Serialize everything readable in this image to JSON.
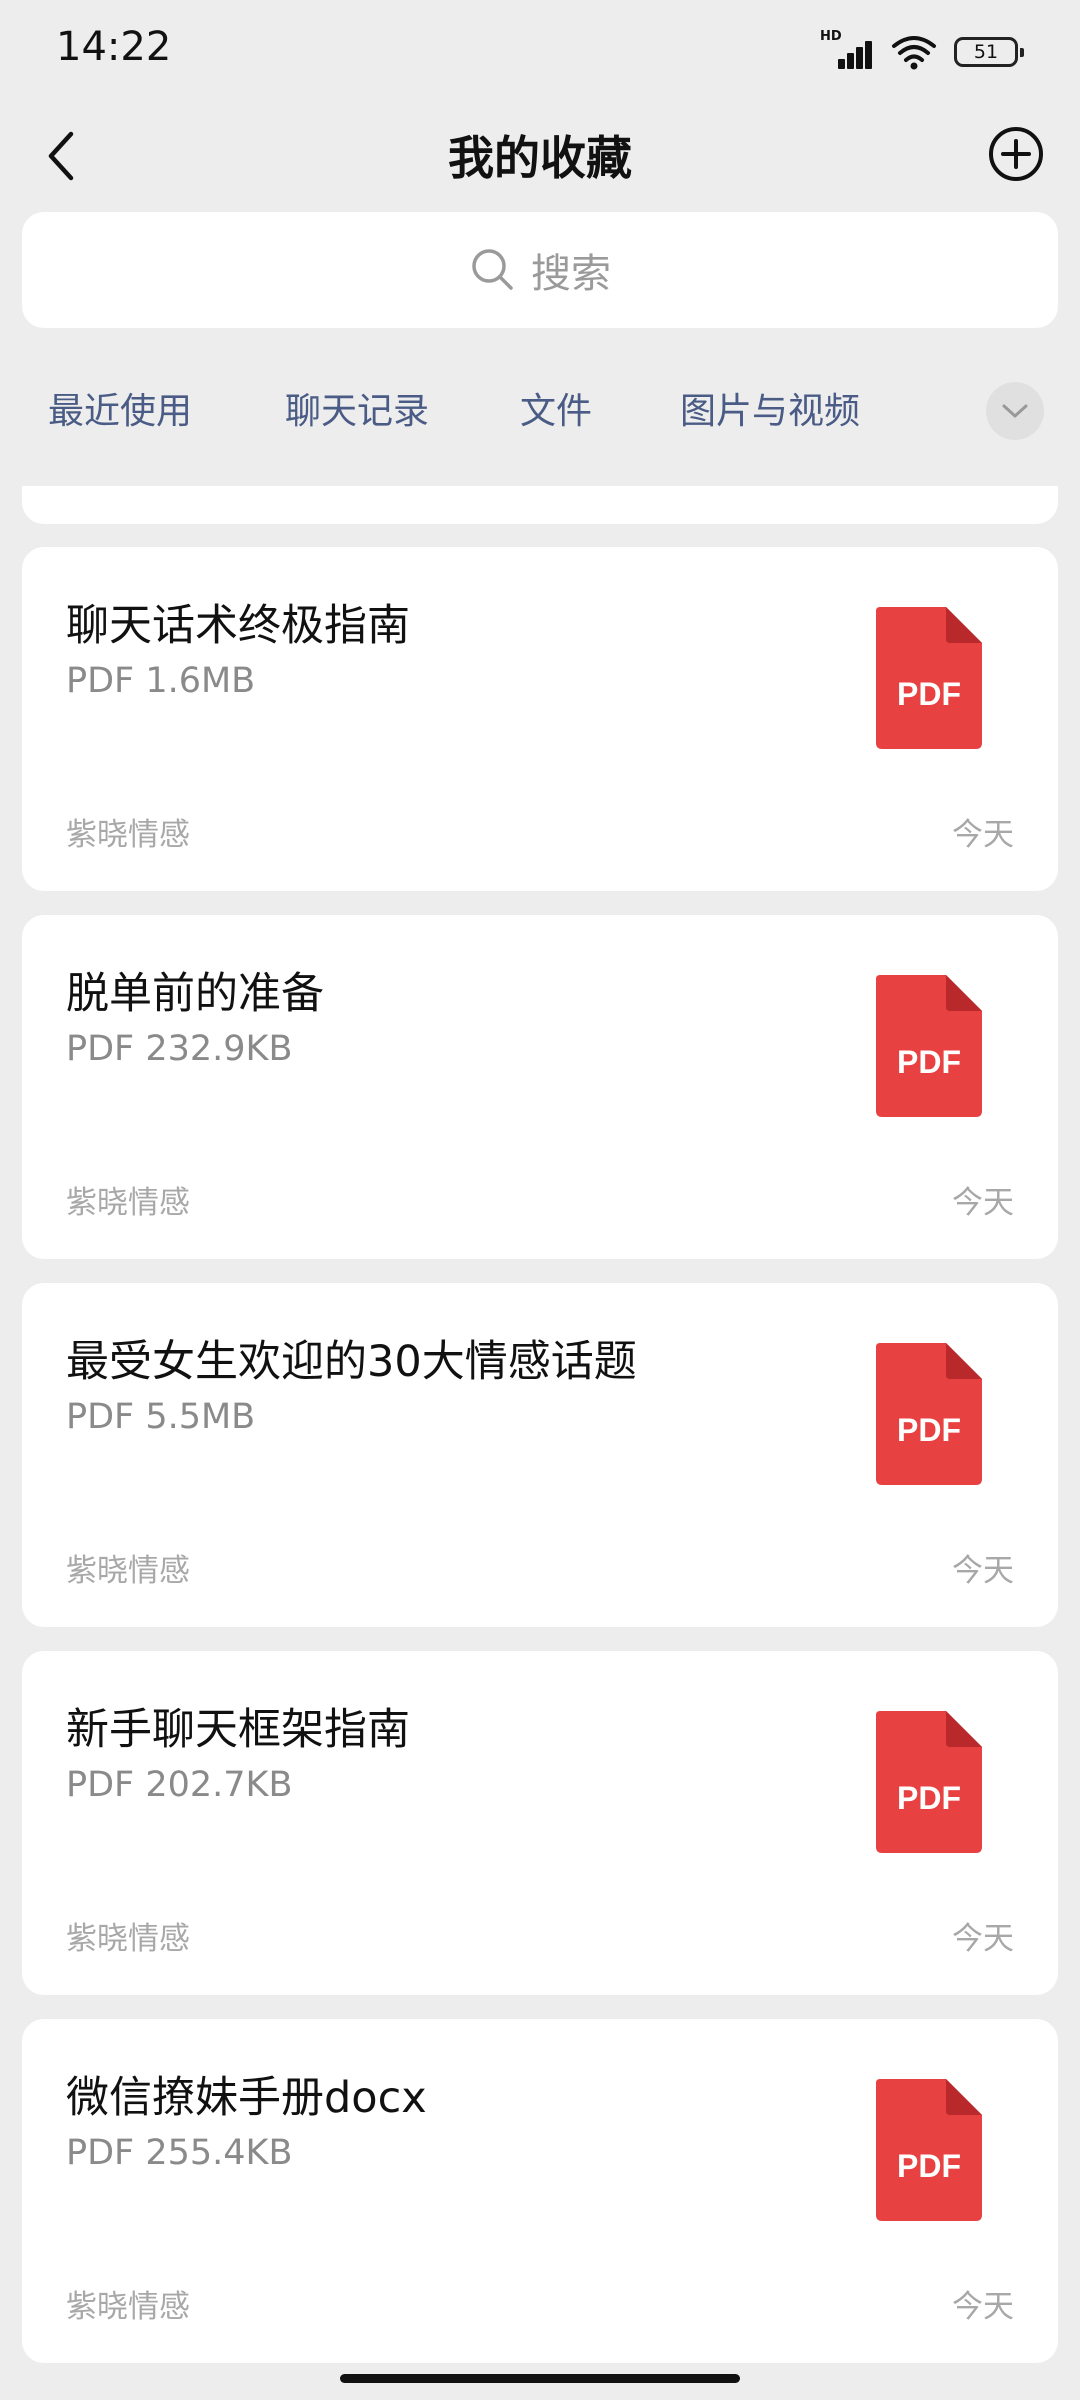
{
  "status_bar": {
    "time": "14:22",
    "network_label": "HD",
    "battery": "51"
  },
  "header": {
    "title": "我的收藏",
    "back_icon": "chevron-left-icon",
    "add_icon": "plus-circle-icon"
  },
  "search": {
    "placeholder": "搜索",
    "icon": "search-icon"
  },
  "tabs": [
    {
      "label": "最近使用"
    },
    {
      "label": "聊天记录"
    },
    {
      "label": "文件"
    },
    {
      "label": "图片与视频"
    }
  ],
  "tabs_more_icon": "chevron-down-icon",
  "items": [
    {
      "title": "聊天话术终极指南",
      "meta": "PDF 1.6MB",
      "source": "紫晓情感",
      "time": "今天",
      "file_badge": "PDF"
    },
    {
      "title": "脱单前的准备",
      "meta": "PDF 232.9KB",
      "source": "紫晓情感",
      "time": "今天",
      "file_badge": "PDF"
    },
    {
      "title": "最受女生欢迎的30大情感话题",
      "meta": "PDF 5.5MB",
      "source": "紫晓情感",
      "time": "今天",
      "file_badge": "PDF"
    },
    {
      "title": "新手聊天框架指南",
      "meta": "PDF 202.7KB",
      "source": "紫晓情感",
      "time": "今天",
      "file_badge": "PDF"
    },
    {
      "title": "微信撩妹手册docx",
      "meta": "PDF 255.4KB",
      "source": "紫晓情感",
      "time": "今天",
      "file_badge": "PDF"
    }
  ],
  "colors": {
    "background": "#ededed",
    "card": "#ffffff",
    "tab_text": "#4a5b85",
    "pdf_red": "#e84142",
    "pdf_fold": "#b9282a"
  }
}
